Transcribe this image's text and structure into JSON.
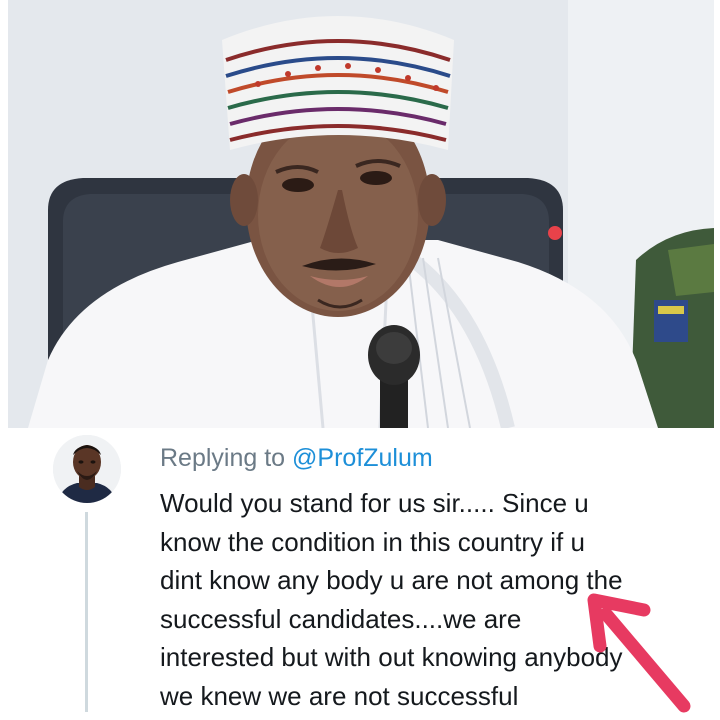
{
  "photo": {
    "description_icon": "person-photo",
    "dot_color": "#e8424a"
  },
  "reply": {
    "replying_prefix": "Replying to",
    "replying_handle": "@ProfZulum",
    "tweet_lines": [
      "Would you stand for us sir..... Since u",
      "know the condition in this country if u",
      "dint know any body u are not among the",
      "successful candidates....we are",
      "interested but with out knowing anybody",
      "we knew we are not successful"
    ],
    "avatar_icon": "user-avatar",
    "annotation_icon": "red-arrow-icon",
    "annotation_color": "#e73a61"
  }
}
